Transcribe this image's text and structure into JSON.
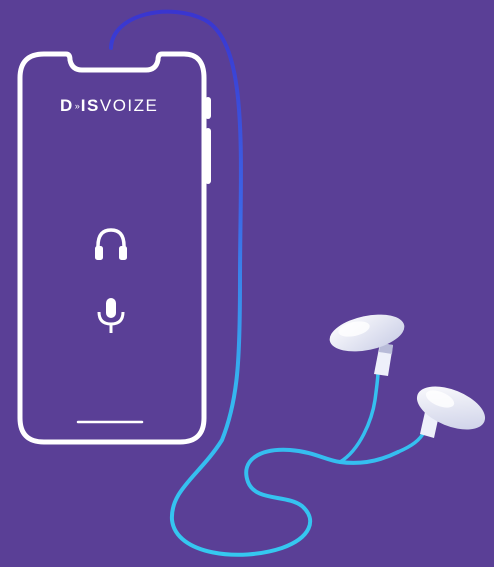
{
  "brand": {
    "part_d": "D",
    "part_waves": "»",
    "part_is": "IS",
    "part_voize": "VOIZE"
  },
  "icons": {
    "headphones": "headphones-icon",
    "microphone": "microphone-icon",
    "earbud": "earbud-icon"
  },
  "colors": {
    "background": "#5a3f96",
    "phone_outline": "#ffffff",
    "cable_start": "#3b3fd6",
    "cable_end": "#35c8f0",
    "earbud": "#e8eaf6"
  }
}
